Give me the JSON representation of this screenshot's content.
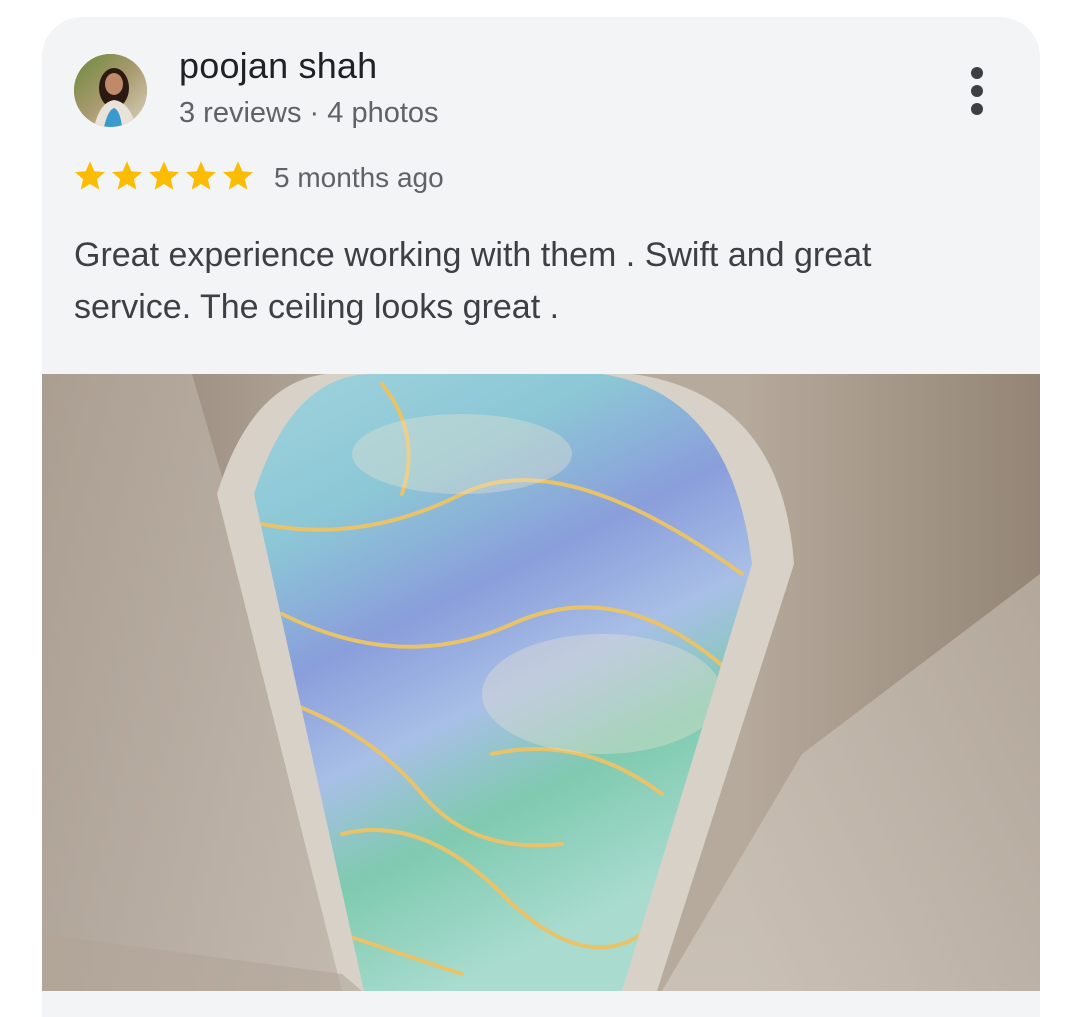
{
  "review": {
    "author_name": "poojan shah",
    "author_meta": "3 reviews · 4 photos",
    "rating": 5,
    "rating_max": 5,
    "time_ago": "5 months ago",
    "text": "Great experience working with them . Swift and great service. The ceiling looks great ."
  },
  "icons": {
    "more": "more-vert-icon",
    "star": "star-icon"
  },
  "colors": {
    "star": "#fbbc04",
    "card_bg": "#f3f4f6",
    "name_text": "#202124",
    "meta_text": "#5f6368",
    "body_text": "#3c4043"
  }
}
